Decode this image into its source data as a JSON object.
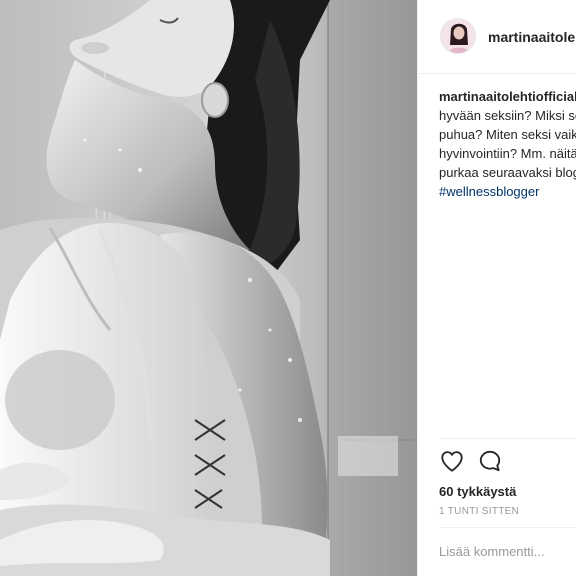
{
  "post": {
    "username": "martinaaitolehtiofficial",
    "header_username": "martinaaitolehtiofficial",
    "caption_lines": [
      "hyvään seksiin? Miksi seks",
      "puhua? Miten seksi vaikut",
      "hyvinvointiin? Mm. näitä a",
      "purkaa seuraavaksi blogissa"
    ],
    "hashtag": "#wellnessblogger",
    "likes": "60 tykkäystä",
    "timestamp": "1 TUNTI SITTEN",
    "comment_placeholder": "Lisää kommentti..."
  },
  "icons": {
    "like": "heart-icon",
    "comment": "comment-bubble-icon"
  },
  "colors": {
    "text": "#262626",
    "hashtag": "#003569",
    "muted": "#999999",
    "divider": "#efefef"
  }
}
